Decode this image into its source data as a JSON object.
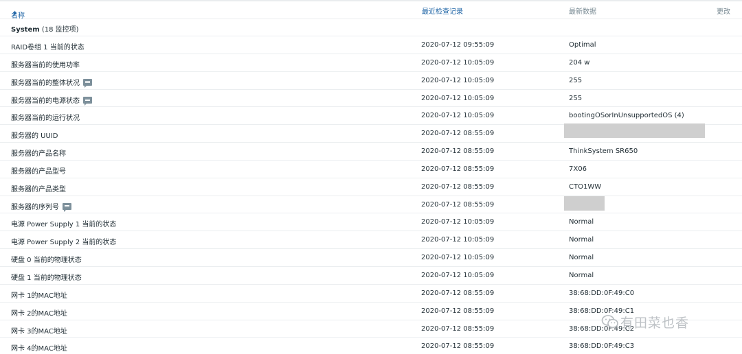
{
  "table": {
    "headers": {
      "name": "名称",
      "sort_indicator": "▲",
      "last_check": "最近检查记录",
      "latest_data": "最新数据",
      "change": "更改"
    },
    "group": {
      "name": "System",
      "count": "(18 监控项)"
    },
    "rows": [
      {
        "name": "RAID卷组 1 当前的状态",
        "time": "2020-07-12 09:55:09",
        "value": "Optimal"
      },
      {
        "name": "服务器当前的使用功率",
        "time": "2020-07-12 10:05:09",
        "value": "204 w"
      },
      {
        "name": "服务器当前的整体状况",
        "time": "2020-07-12 10:05:09",
        "value": "255"
      },
      {
        "name": "服务器当前的电源状态",
        "time": "2020-07-12 10:05:09",
        "value": "255"
      },
      {
        "name": "服务器当前的运行状况",
        "time": "2020-07-12 10:05:09",
        "value": "bootingOSorInUnsupportedOS (4)"
      },
      {
        "name": "服务器的 UUID",
        "time": "2020-07-12 08:55:09",
        "value": ""
      },
      {
        "name": "服务器的产品名称",
        "time": "2020-07-12 08:55:09",
        "value": "ThinkSystem SR650"
      },
      {
        "name": "服务器的产品型号",
        "time": "2020-07-12 08:55:09",
        "value": "7X06"
      },
      {
        "name": "服务器的产品类型",
        "time": "2020-07-12 08:55:09",
        "value": "CTO1WW"
      },
      {
        "name": "服务器的序列号",
        "time": "2020-07-12 08:55:09",
        "value": ""
      },
      {
        "name": "电源 Power Supply 1 当前的状态",
        "time": "2020-07-12 10:05:09",
        "value": "Normal"
      },
      {
        "name": "电源 Power Supply 2 当前的状态",
        "time": "2020-07-12 10:05:09",
        "value": "Normal"
      },
      {
        "name": "硬盘 0 当前的物理状态",
        "time": "2020-07-12 10:05:09",
        "value": "Normal"
      },
      {
        "name": "硬盘 1 当前的物理状态",
        "time": "2020-07-12 10:05:09",
        "value": "Normal"
      },
      {
        "name": "网卡 1的MAC地址",
        "time": "2020-07-12 08:55:09",
        "value": "38:68:DD:0F:49:C0"
      },
      {
        "name": "网卡 2的MAC地址",
        "time": "2020-07-12 08:55:09",
        "value": "38:68:DD:0F:49:C1"
      },
      {
        "name": "网卡 3的MAC地址",
        "time": "2020-07-12 08:55:09",
        "value": "38:68:DD:0F:49:C2"
      },
      {
        "name": "网卡 4的MAC地址",
        "time": "2020-07-12 08:55:09",
        "value": "38:68:DD:0F:49:C3"
      }
    ]
  },
  "icons": {
    "hint": "speech-bubble-icon",
    "watermark": "wechat-icon"
  },
  "watermark": {
    "text": "有田菜也香"
  }
}
